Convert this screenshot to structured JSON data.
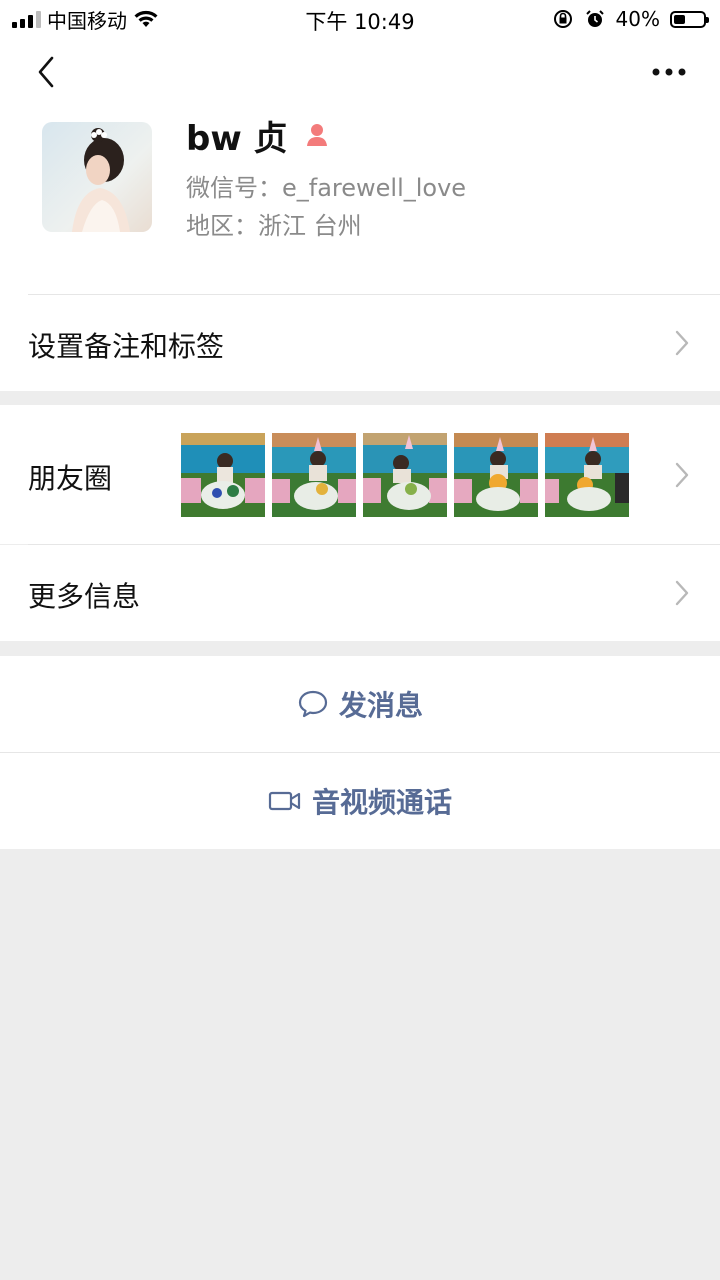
{
  "status_bar": {
    "carrier": "中国移动",
    "time": "下午 10:49",
    "battery_percent": "40%",
    "battery_level": 0.4,
    "icons": [
      "signal-icon",
      "wifi-icon",
      "rotation-lock-icon",
      "alarm-icon",
      "battery-icon"
    ]
  },
  "nav": {
    "back_icon": "chevron-left-icon",
    "more_icon": "more-dots-icon"
  },
  "profile": {
    "name": "bw 贞",
    "gender_icon": "female-icon",
    "wechat_id": "微信号：e_farewell_love",
    "region": "地区：浙江 台州"
  },
  "menu": {
    "remark_label": "设置备注和标签",
    "moments_label": "朋友圈",
    "more_info_label": "更多信息"
  },
  "actions": {
    "message_label": "发消息",
    "call_label": "音视频通话"
  },
  "colors": {
    "link": "#576b95",
    "background": "#ededed",
    "female_icon": "#f37b7b"
  }
}
